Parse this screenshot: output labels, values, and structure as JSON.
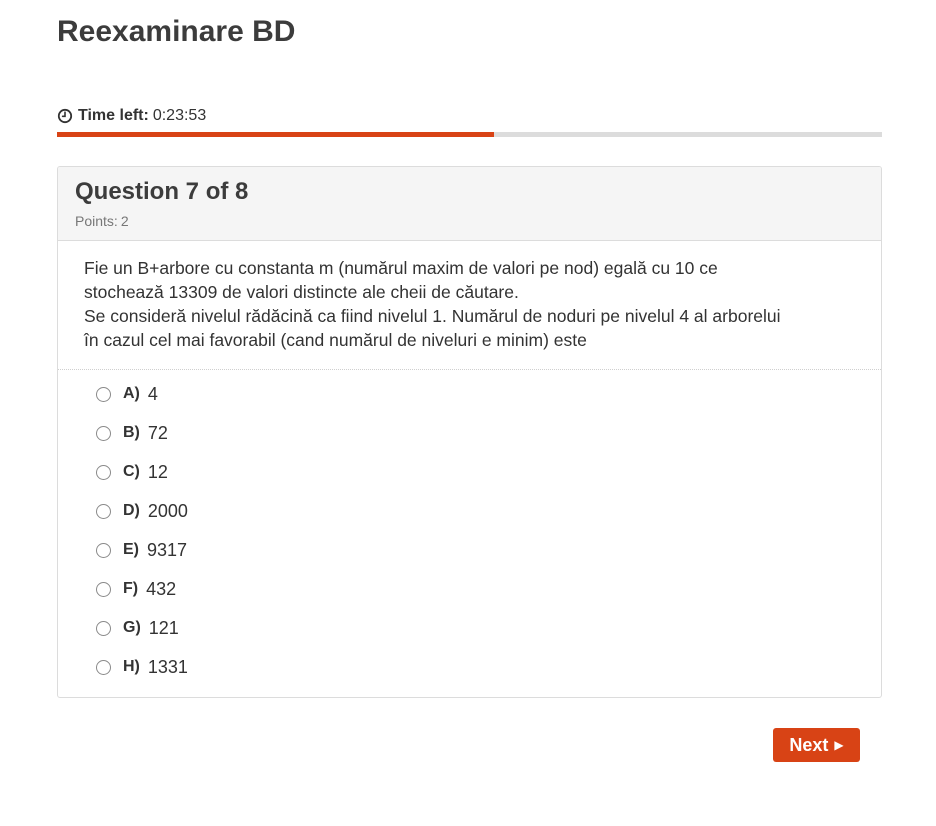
{
  "page": {
    "title": "Reexaminare BD"
  },
  "timer": {
    "label": "Time left:",
    "value": "0:23:53",
    "progress_fraction": 0.53
  },
  "question": {
    "title": "Question 7 of 8",
    "points_label": "Points:",
    "points_value": "2",
    "text_lines": [
      "Fie un B+arbore cu constanta m (numărul maxim de valori pe nod) egală cu 10 ce",
      "stochează 13309 de valori distincte ale cheii de căutare.",
      "Se consideră nivelul rădăcină ca fiind nivelul 1. Numărul de noduri pe nivelul 4 al arborelui",
      "în cazul cel mai favorabil (cand numărul de niveluri e minim) este"
    ]
  },
  "answers": [
    {
      "letter": "A)",
      "value": "4"
    },
    {
      "letter": "B)",
      "value": "72"
    },
    {
      "letter": "C)",
      "value": "12"
    },
    {
      "letter": "D)",
      "value": "2000"
    },
    {
      "letter": "E)",
      "value": "9317"
    },
    {
      "letter": "F)",
      "value": "432"
    },
    {
      "letter": "G)",
      "value": "121"
    },
    {
      "letter": "H)",
      "value": "1331"
    }
  ],
  "buttons": {
    "next_label": "Next"
  },
  "colors": {
    "accent": "#d84315",
    "progress_track": "#dcdcdc"
  }
}
